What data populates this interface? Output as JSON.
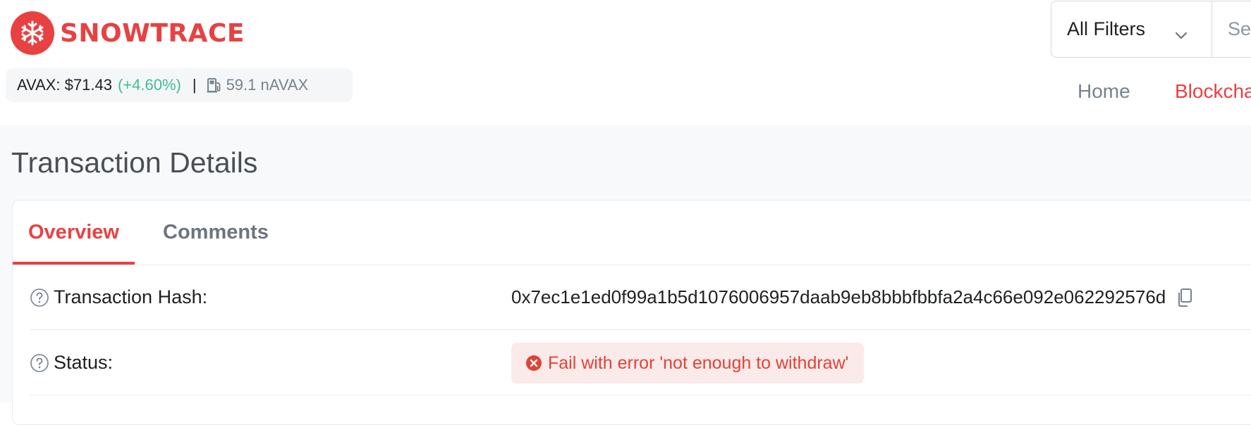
{
  "brand": {
    "name": "SNOWTRACE",
    "color": "#e84142"
  },
  "price_bar": {
    "price_label": "AVAX: $71.43",
    "change": "(+4.60%)",
    "separator": "|",
    "gas_value": "59.1 nAVAX",
    "gas_icon": "gas-pump-icon"
  },
  "search": {
    "filter_value": "All Filters",
    "placeholder": "Se"
  },
  "nav": {
    "items": [
      {
        "label": "Home"
      },
      {
        "label": "Blockcha"
      }
    ]
  },
  "page": {
    "title": "Transaction Details"
  },
  "tabs": [
    {
      "label": "Overview",
      "active": true
    },
    {
      "label": "Comments",
      "active": false
    }
  ],
  "details": {
    "hash": {
      "label": "Transaction Hash:",
      "value": "0x7ec1e1ed0f99a1b5d1076006957daab9eb8bbbfbbfa2a4c66e092e062292576d"
    },
    "status": {
      "label": "Status:",
      "value": "Fail with error 'not enough to withdraw'",
      "color": "#de4437"
    }
  }
}
